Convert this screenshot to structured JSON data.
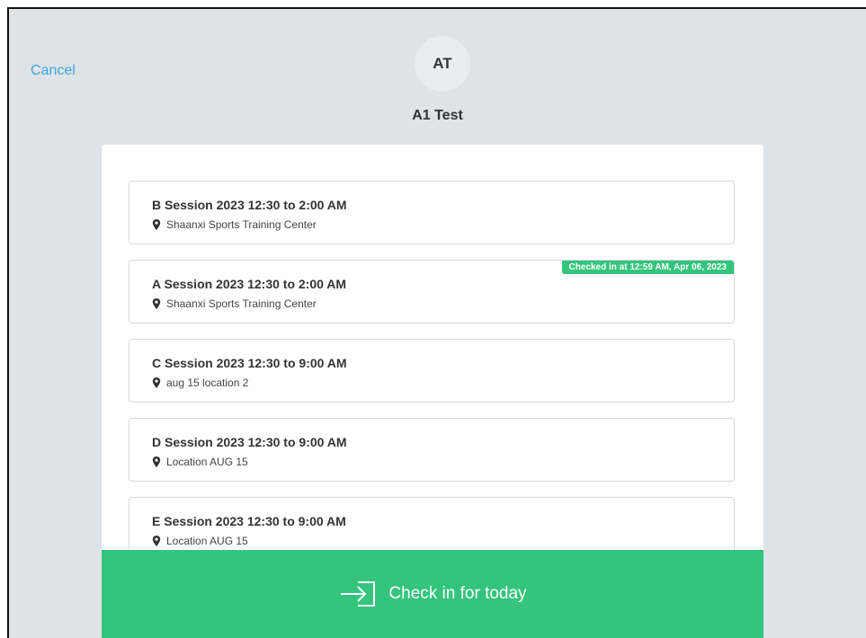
{
  "header": {
    "cancel_label": "Cancel",
    "avatar_initials": "AT",
    "profile_name": "A1 Test"
  },
  "sessions": [
    {
      "title": "B Session 2023 12:30 to 2:00 AM",
      "location": "Shaanxi Sports Training Center",
      "badge": ""
    },
    {
      "title": "A Session 2023 12:30 to 2:00 AM",
      "location": "Shaanxi Sports Training Center",
      "badge": "Checked in at 12:59 AM, Apr 06, 2023"
    },
    {
      "title": "C Session 2023 12:30 to 9:00 AM",
      "location": "aug 15 location 2",
      "badge": ""
    },
    {
      "title": "D Session 2023 12:30 to 9:00 AM",
      "location": "Location AUG 15",
      "badge": ""
    },
    {
      "title": "E Session 2023 12:30 to 9:00 AM",
      "location": "Location AUG 15",
      "badge": ""
    }
  ],
  "footer": {
    "checkin_label": "Check in for today"
  },
  "colors": {
    "accent": "#34c47c",
    "link": "#3aa7dc",
    "background": "#dde3e7"
  },
  "icons": {
    "location": "map-pin-icon",
    "checkin": "enter-icon"
  }
}
